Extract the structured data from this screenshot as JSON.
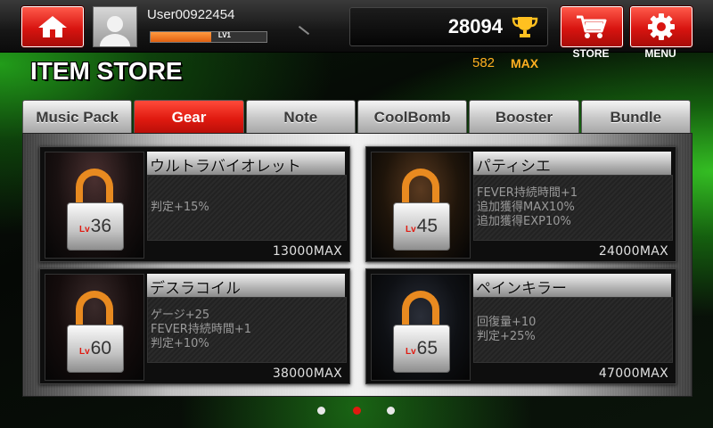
{
  "header": {
    "username": "User00922454",
    "level_tag": "LV1",
    "xp_fraction": 0.52,
    "score": "28094",
    "max_count": "582",
    "max_label": "MAX",
    "store_label": "STORE",
    "menu_label": "MENU"
  },
  "page": {
    "title": "ITEM STORE"
  },
  "tabs": [
    {
      "label": "Music Pack",
      "active": false
    },
    {
      "label": "Gear",
      "active": true
    },
    {
      "label": "Note",
      "active": false
    },
    {
      "label": "CoolBomb",
      "active": false
    },
    {
      "label": "Booster",
      "active": false
    },
    {
      "label": "Bundle",
      "active": false
    }
  ],
  "items": [
    {
      "name": "ウルトラバイオレット",
      "lv_prefix": "Lv",
      "level": "36",
      "desc": [
        "判定+15%"
      ],
      "price": "13000MAX"
    },
    {
      "name": "パティシエ",
      "lv_prefix": "Lv",
      "level": "45",
      "desc": [
        "FEVER持続時間+1",
        "追加獲得MAX10%",
        "追加獲得EXP10%"
      ],
      "price": "24000MAX"
    },
    {
      "name": "デスラコイル",
      "lv_prefix": "Lv",
      "level": "60",
      "desc": [
        "ゲージ+25",
        "FEVER持続時間+1",
        "判定+10%"
      ],
      "price": "38000MAX"
    },
    {
      "name": "ペインキラー",
      "lv_prefix": "Lv",
      "level": "65",
      "desc": [
        "回復量+10",
        "判定+25%"
      ],
      "price": "47000MAX"
    }
  ],
  "pagination": {
    "pages": 3,
    "current_index": 1
  },
  "colors": {
    "accent_red": "#e01a10",
    "max_gold": "#ffb020",
    "lock_orange": "#e88a20"
  }
}
